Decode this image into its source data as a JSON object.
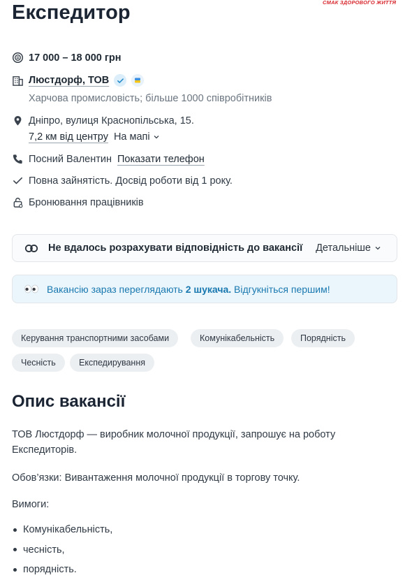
{
  "header": {
    "title": "Експедитор",
    "logo_text": "СМАК ЗДОРОВОГО ЖИТТЯ"
  },
  "details": {
    "salary": "17 000 – 18 000 грн",
    "company": "Люстдорф, ТОВ",
    "company_info": "Харчова промисловість; більше 1000 співробітників",
    "address": "Дніпро, вулиця Краснопільська, 15.",
    "distance": "7,2 км від центру",
    "map_toggle": "На мапі",
    "contact_name": "Посний Валентин",
    "show_phone": "Показати телефон",
    "employment": "Повна зайнятість. Досвід роботи від 1 року.",
    "reservation": "Бронювання працівників"
  },
  "match": {
    "text": "Не вдалось розрахувати відповідність до вакансії",
    "details_label": "Детальніше"
  },
  "views": {
    "prefix": "Вакансію зараз переглядають",
    "count": "2 шукача.",
    "suffix": "Відгукніться першим!"
  },
  "tags": [
    "Керування транспортними засобами",
    "Комунікабельність",
    "Порядність",
    "Чесність",
    "Експедирування"
  ],
  "description": {
    "title": "Опис вакансії",
    "intro": "ТОВ Люстдорф — виробник молочної продукції, запрошує на роботу Експедиторів.",
    "duties": "Обов’язки: Вивантаження молочної продукції в торгову точку.",
    "requirements_label": "Вимоги:",
    "requirements": [
      "Комунікабельність,",
      "чесність,",
      "порядність."
    ]
  },
  "colors": {
    "accent": "#1978b0",
    "views_bg": "#eaf6fb",
    "tag_bg": "#eceff2",
    "logo_red": "#d8262d"
  },
  "icons": [
    "coin-icon",
    "building-icon",
    "verified-icon",
    "ukraine-flag-icon",
    "location-pin-icon",
    "chevron-down-icon",
    "phone-icon",
    "checkmark-icon",
    "lock-icon",
    "match-rings-icon",
    "eyes-icon"
  ]
}
